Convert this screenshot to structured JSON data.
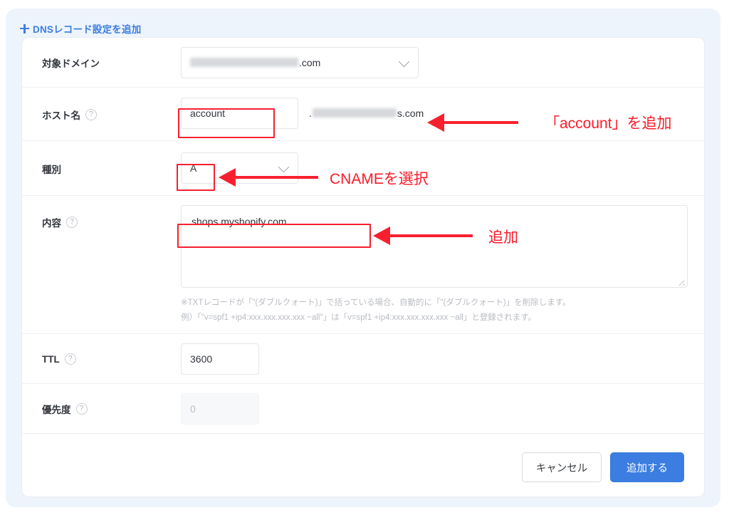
{
  "panel": {
    "header_label": "DNSレコード設定を追加",
    "plus_icon": "plus-icon"
  },
  "form": {
    "rows": [
      {
        "label": "対象ドメイン",
        "has_help": false,
        "value_suffix": ".com",
        "redacted": true
      },
      {
        "label": "ホスト名",
        "has_help": true,
        "value": "account",
        "suffix_visible": "s.com",
        "redacted": true
      },
      {
        "label": "種別",
        "has_help": false,
        "value": "A"
      },
      {
        "label": "内容",
        "has_help": true,
        "value": "shops.myshopify.com",
        "note_line1": "※TXTレコードが「\"(ダブルクォート)」で括っている場合、自動的に「\"(ダブルクォート)」を削除します。",
        "note_line2": "例）「\"v=spf1 +ip4:xxx.xxx.xxx.xxx ~all\"」は「v=spf1 +ip4:xxx.xxx.xxx.xxx ~all」と登録されます。"
      },
      {
        "label": "TTL",
        "has_help": true,
        "value": "3600"
      },
      {
        "label": "優先度",
        "has_help": true,
        "value": "0",
        "disabled": true
      }
    ],
    "help_glyph": "?"
  },
  "buttons": {
    "cancel": "キャンセル",
    "submit": "追加する"
  },
  "annotations": [
    {
      "text": "「account」を追加"
    },
    {
      "text": "CNAMEを選択"
    },
    {
      "text": "追加"
    }
  ],
  "colors": {
    "accent_blue": "#3b7de0",
    "panel_bg": "#eef4fc",
    "annotation_red": "#f8202f",
    "text_primary": "#32363c",
    "note_gray": "#b9bcc2"
  }
}
